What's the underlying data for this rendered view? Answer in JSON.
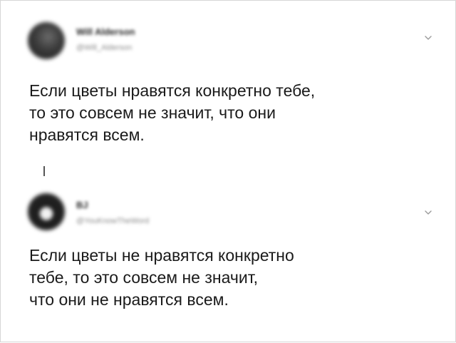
{
  "tweets": [
    {
      "display_name": "Will Alderson",
      "handle": "@Will_Alderson",
      "text": "Если цветы нравятся конкретно тебе,\nто это совсем не значит, что они\nнравятся всем.",
      "avatar_icon": "user-avatar-icon",
      "menu_icon": "chevron-down-icon"
    },
    {
      "display_name": "BJ",
      "handle": "@YouKnowTheWord",
      "text": "Если цветы не нравятся конкретно\nтебе, то это совсем не значит,\nчто они не нравятся всем.",
      "avatar_icon": "user-avatar-icon",
      "menu_icon": "chevron-down-icon"
    }
  ],
  "colors": {
    "background": "#ffffff",
    "text": "#1a1a1a",
    "handle": "#8a8a8a",
    "thread_line": "#555555",
    "frame_border": "#d6d6d6"
  }
}
